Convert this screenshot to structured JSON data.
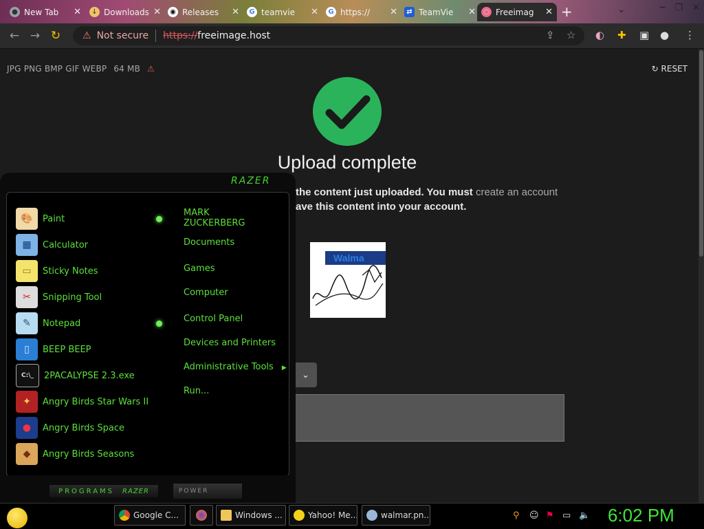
{
  "browser": {
    "tabs": [
      {
        "label": "New Tab",
        "icon": "chrome-icon",
        "color": "#9aa0a6"
      },
      {
        "label": "Downloads",
        "icon": "download-icon",
        "color": "#f0c36a"
      },
      {
        "label": "Releases",
        "icon": "github-icon",
        "color": "#ffffff"
      },
      {
        "label": "teamvie",
        "icon": "google-icon",
        "color": "#4285f4"
      },
      {
        "label": "https://",
        "icon": "google-icon",
        "color": "#4285f4"
      },
      {
        "label": "TeamVie",
        "icon": "teamviewer-icon",
        "color": "#1d5dd8"
      },
      {
        "label": "Freeimag",
        "icon": "freeimage-icon",
        "color": "#e86a8a"
      }
    ],
    "new_tab": "+",
    "address": {
      "warning": "Not secure",
      "scheme": "https://",
      "host": "freeimage.host"
    }
  },
  "page": {
    "formats": "JPG PNG BMP GIF WEBP",
    "max_size": "64 MB",
    "reset_label": "RESET",
    "title": "Upload complete",
    "message_line1_start": "the content just uploaded. You must",
    "message_link": "create an account",
    "message_line2": "ave this content into your account.",
    "thumb_text": "Walma"
  },
  "start_menu": {
    "brand": "RAZER",
    "apps": [
      {
        "label": "Paint",
        "icon": "paint-icon",
        "pinned": true
      },
      {
        "label": "Calculator",
        "icon": "calculator-icon",
        "pinned": false
      },
      {
        "label": "Sticky Notes",
        "icon": "sticky-notes-icon",
        "pinned": false
      },
      {
        "label": "Snipping Tool",
        "icon": "snipping-tool-icon",
        "pinned": false
      },
      {
        "label": "Notepad",
        "icon": "notepad-icon",
        "pinned": true
      },
      {
        "label": "BEEP BEEP",
        "icon": "phone-icon",
        "pinned": false
      },
      {
        "label": "2PACALYPSE 2.3.exe",
        "icon": "console-icon",
        "pinned": false
      },
      {
        "label": "Angry Birds Star Wars II",
        "icon": "angry-birds-star-wars-icon",
        "pinned": false
      },
      {
        "label": "Angry Birds Space",
        "icon": "angry-birds-space-icon",
        "pinned": false
      },
      {
        "label": "Angry Birds Seasons",
        "icon": "angry-birds-seasons-icon",
        "pinned": false
      }
    ],
    "places": [
      {
        "label": "MARK",
        "label2": "ZUCKERBERG"
      },
      {
        "label": "Documents"
      },
      {
        "label": "Games"
      },
      {
        "label": "Computer"
      },
      {
        "label": "Control Panel"
      },
      {
        "label": "Devices and Printers"
      },
      {
        "label": "Administrative Tools"
      },
      {
        "label": "Run..."
      }
    ],
    "programs_label": "PROGRAMS",
    "programs_brand": "RAZER",
    "power_label": "POWER"
  },
  "taskbar": {
    "items": [
      {
        "label": "Google C...",
        "icon": "chrome-icon"
      },
      {
        "label": "",
        "icon": "firefox-icon"
      },
      {
        "label": "Windows ...",
        "icon": "folder-icon"
      },
      {
        "label": "Yahoo! Me...",
        "icon": "yahoo-messenger-icon"
      },
      {
        "label": "walmar.pn...",
        "icon": "image-viewer-icon"
      }
    ],
    "clock": "6:02 PM"
  }
}
